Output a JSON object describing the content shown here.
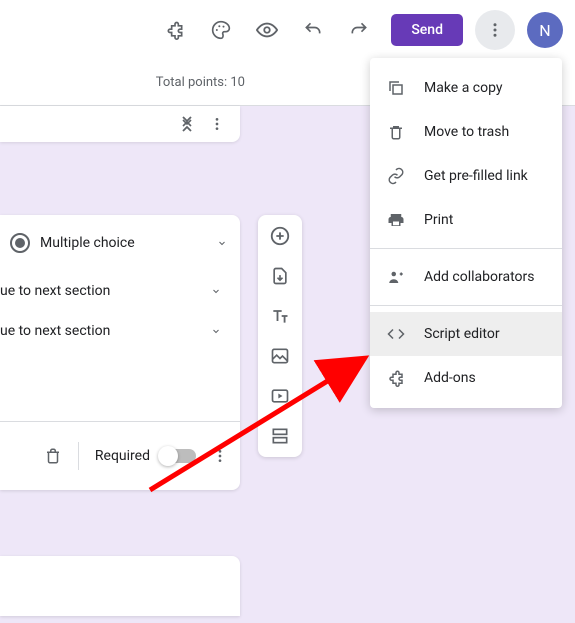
{
  "topbar": {
    "send_label": "Send",
    "avatar_initial": "N"
  },
  "points_text": "Total points: 10",
  "question": {
    "type_label": "Multiple choice",
    "goto_rows": [
      "ue to next section",
      "ue to next section"
    ],
    "required_label": "Required"
  },
  "menu": {
    "items": [
      {
        "label": "Make a copy",
        "icon": "copy"
      },
      {
        "label": "Move to trash",
        "icon": "trash"
      },
      {
        "label": "Get pre-filled link",
        "icon": "link"
      },
      {
        "label": "Print",
        "icon": "print"
      }
    ],
    "items2": [
      {
        "label": "Add collaborators",
        "icon": "people"
      }
    ],
    "items3": [
      {
        "label": "Script editor",
        "icon": "code"
      },
      {
        "label": "Add-ons",
        "icon": "addon"
      }
    ]
  }
}
